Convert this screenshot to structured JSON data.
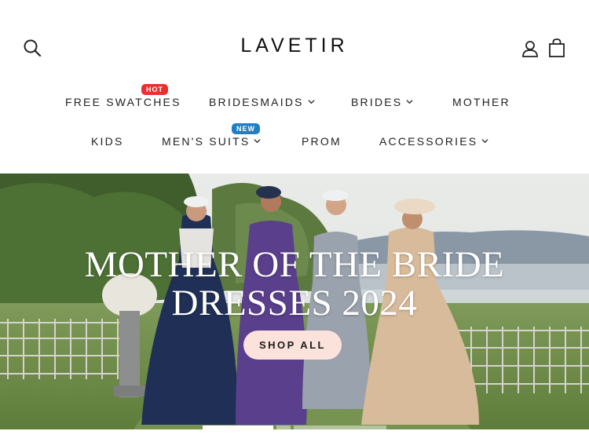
{
  "header": {
    "logo": "LAVETIR",
    "icons": [
      "search-icon",
      "account-icon",
      "cart-icon"
    ]
  },
  "nav": {
    "row1": [
      {
        "label": "FREE SWATCHES",
        "badge": "HOT",
        "dropdown": false
      },
      {
        "label": "BRIDESMAIDS",
        "dropdown": true
      },
      {
        "label": "BRIDES",
        "dropdown": true
      },
      {
        "label": "MOTHER",
        "dropdown": false
      }
    ],
    "row2": [
      {
        "label": "KIDS",
        "dropdown": false
      },
      {
        "label": "MEN'S SUITS",
        "badge": "NEW",
        "dropdown": true
      },
      {
        "label": "PROM",
        "dropdown": false
      },
      {
        "label": "ACCESSORIES",
        "dropdown": true
      }
    ]
  },
  "hero": {
    "title_line1": "MOTHER OF THE BRIDE",
    "title_line2": "DRESSES 2024",
    "cta": "SHOP ALL",
    "slides_total": 3,
    "active_slide": 1
  },
  "colors": {
    "hot_badge": "#e8302f",
    "new_badge": "#1f7fc4",
    "cta_bg": "#fbe3dc",
    "text": "#1a1a1a"
  }
}
